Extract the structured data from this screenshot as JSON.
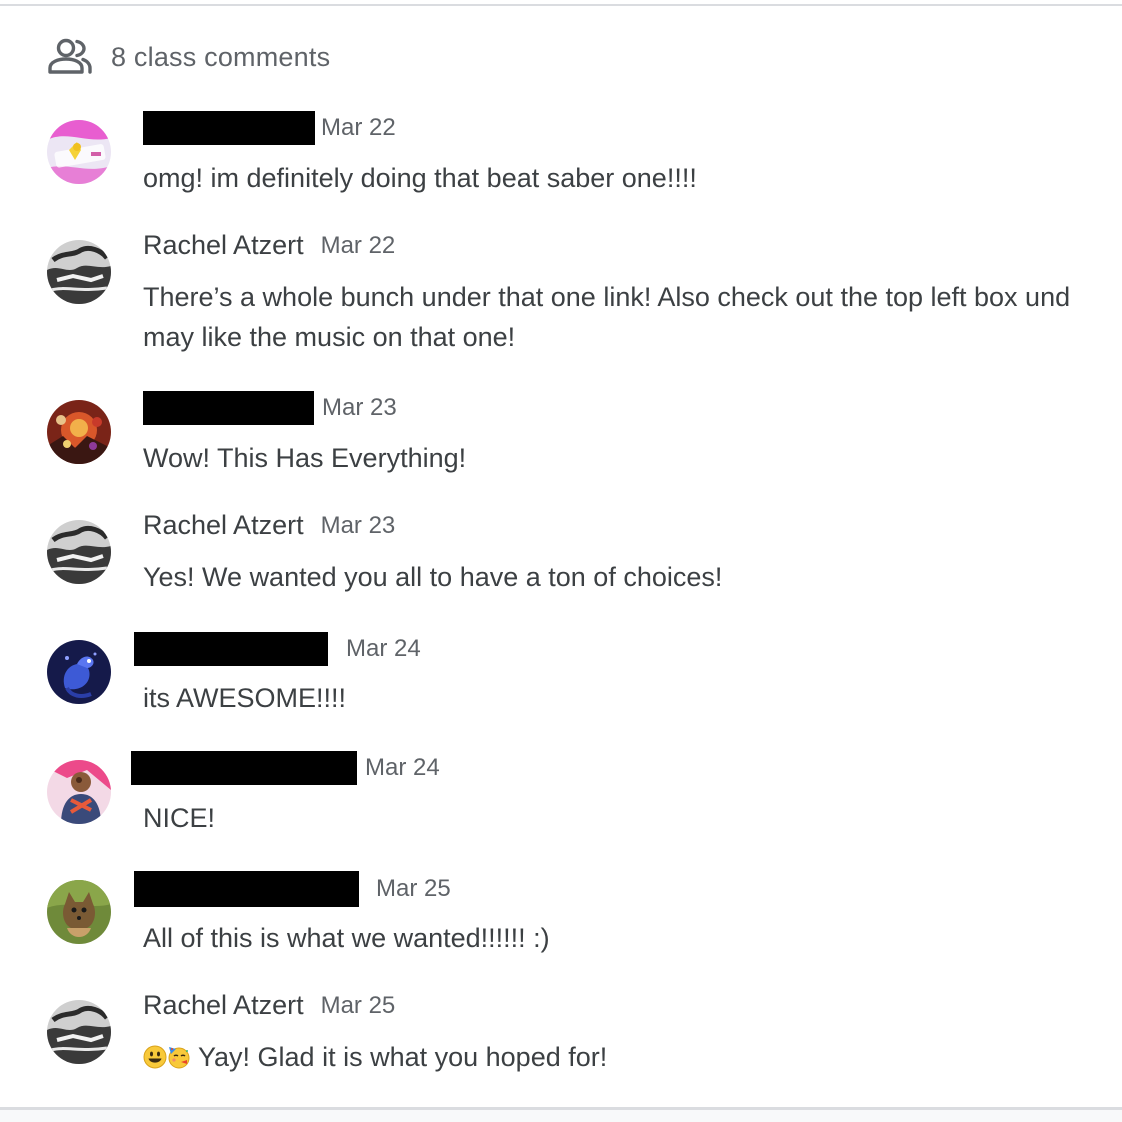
{
  "header": {
    "count_label": "8 class comments",
    "icon": "people-icon"
  },
  "comments": [
    {
      "author": "",
      "author_redacted": true,
      "date": "Mar 22",
      "lines": [
        "omg! im definitely doing that beat saber one!!!!"
      ],
      "avatar": "pink-cartoon-avatar"
    },
    {
      "author": "Rachel Atzert",
      "author_redacted": false,
      "date": "Mar 22",
      "lines": [
        "There’s a whole bunch under that one link! Also check out the top left box und",
        "may like the music on that one!"
      ],
      "avatar": "bw-photo-avatar"
    },
    {
      "author": "",
      "author_redacted": true,
      "date": "Mar 23",
      "lines": [
        "Wow! This Has Everything!"
      ],
      "avatar": "movie-poster-avatar"
    },
    {
      "author": "Rachel Atzert",
      "author_redacted": false,
      "date": "Mar 23",
      "lines": [
        "Yes! We wanted you all to have a ton of choices!"
      ],
      "avatar": "bw-photo-avatar"
    },
    {
      "author": "",
      "author_redacted": true,
      "date": "Mar 24",
      "lines": [
        "its AWESOME!!!!"
      ],
      "avatar": "blue-lizard-avatar"
    },
    {
      "author": "",
      "author_redacted": true,
      "date": "Mar 24",
      "lines": [
        "NICE!"
      ],
      "avatar": "pink-character-avatar"
    },
    {
      "author": "",
      "author_redacted": true,
      "date": "Mar 25",
      "lines": [
        "All of this is what we wanted!!!!!! :)"
      ],
      "avatar": "dog-photo-avatar"
    },
    {
      "author": "Rachel Atzert",
      "author_redacted": false,
      "date": "Mar 25",
      "lines": [
        "Yay! Glad it is what you hoped for!"
      ],
      "emojis": [
        "smiley-emoji",
        "partying-face-emoji"
      ],
      "avatar": "bw-photo-avatar"
    }
  ],
  "colors": {
    "text": "#3c4043",
    "secondary_text": "#5f6368",
    "divider": "#dadce0",
    "redaction": "#000000"
  }
}
